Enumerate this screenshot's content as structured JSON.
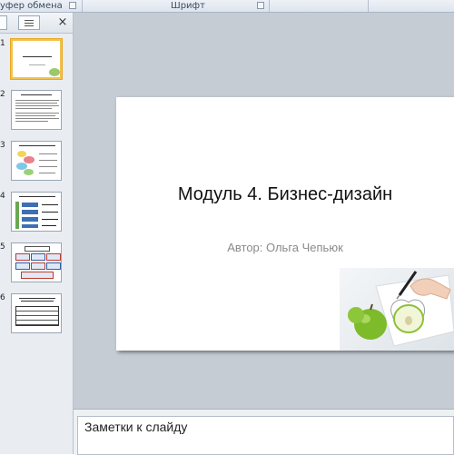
{
  "ribbon": {
    "clipboard_group": "уфер обмена",
    "font_group": "Шрифт"
  },
  "slide_panel": {
    "close_glyph": "×",
    "thumbnails": [
      {
        "number": "1",
        "selected": true
      },
      {
        "number": "2",
        "selected": false
      },
      {
        "number": "3",
        "selected": false
      },
      {
        "number": "4",
        "selected": false
      },
      {
        "number": "5",
        "selected": false
      },
      {
        "number": "6",
        "selected": false
      }
    ]
  },
  "slide": {
    "title": "Модуль 4. Бизнес-дизайн",
    "subtitle": "Автор:  Ольга Чепьюк",
    "picture": "green-apple-and-pen-drawing"
  },
  "notes": {
    "placeholder": "Заметки к слайду"
  },
  "colors": {
    "workspace": "#c6ccd3",
    "selection": "#f2c24d",
    "apple": "#7dbb2a"
  }
}
